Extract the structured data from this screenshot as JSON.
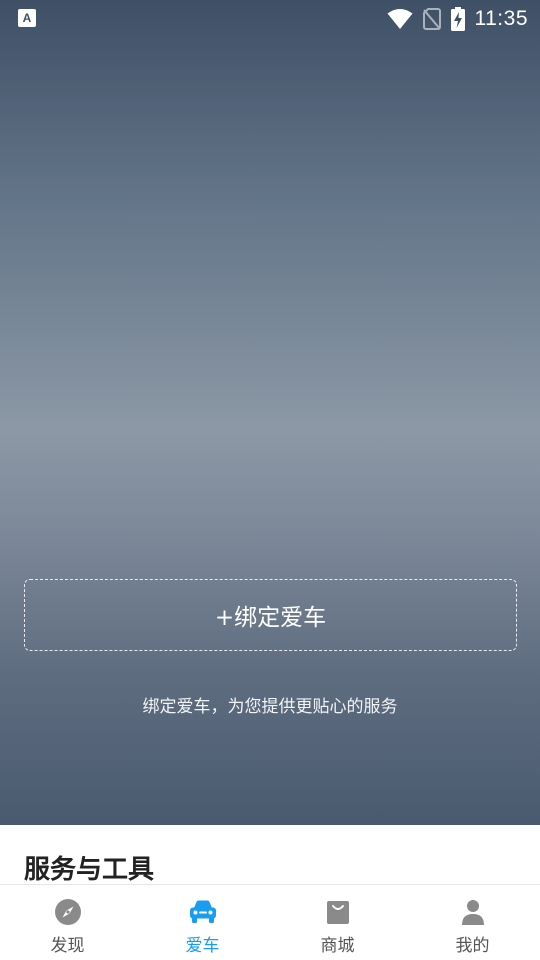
{
  "status_bar": {
    "time": "11:35",
    "notification_icon_letter": "A",
    "icons": [
      "wifi-icon",
      "no-sim-icon",
      "battery-charging-icon"
    ]
  },
  "hero": {
    "bind_button_label": "+绑定爱车",
    "hint": "绑定爱车，为您提供更贴心的服务"
  },
  "services": {
    "title": "服务与工具"
  },
  "tab_bar": {
    "active_color": "#1a9cf0",
    "inactive_color": "#8a8a8a",
    "tabs": [
      {
        "label": "发现",
        "icon": "compass-icon"
      },
      {
        "label": "爱车",
        "icon": "car-icon"
      },
      {
        "label": "商城",
        "icon": "shopping-bag-icon"
      },
      {
        "label": "我的",
        "icon": "user-icon"
      }
    ]
  }
}
